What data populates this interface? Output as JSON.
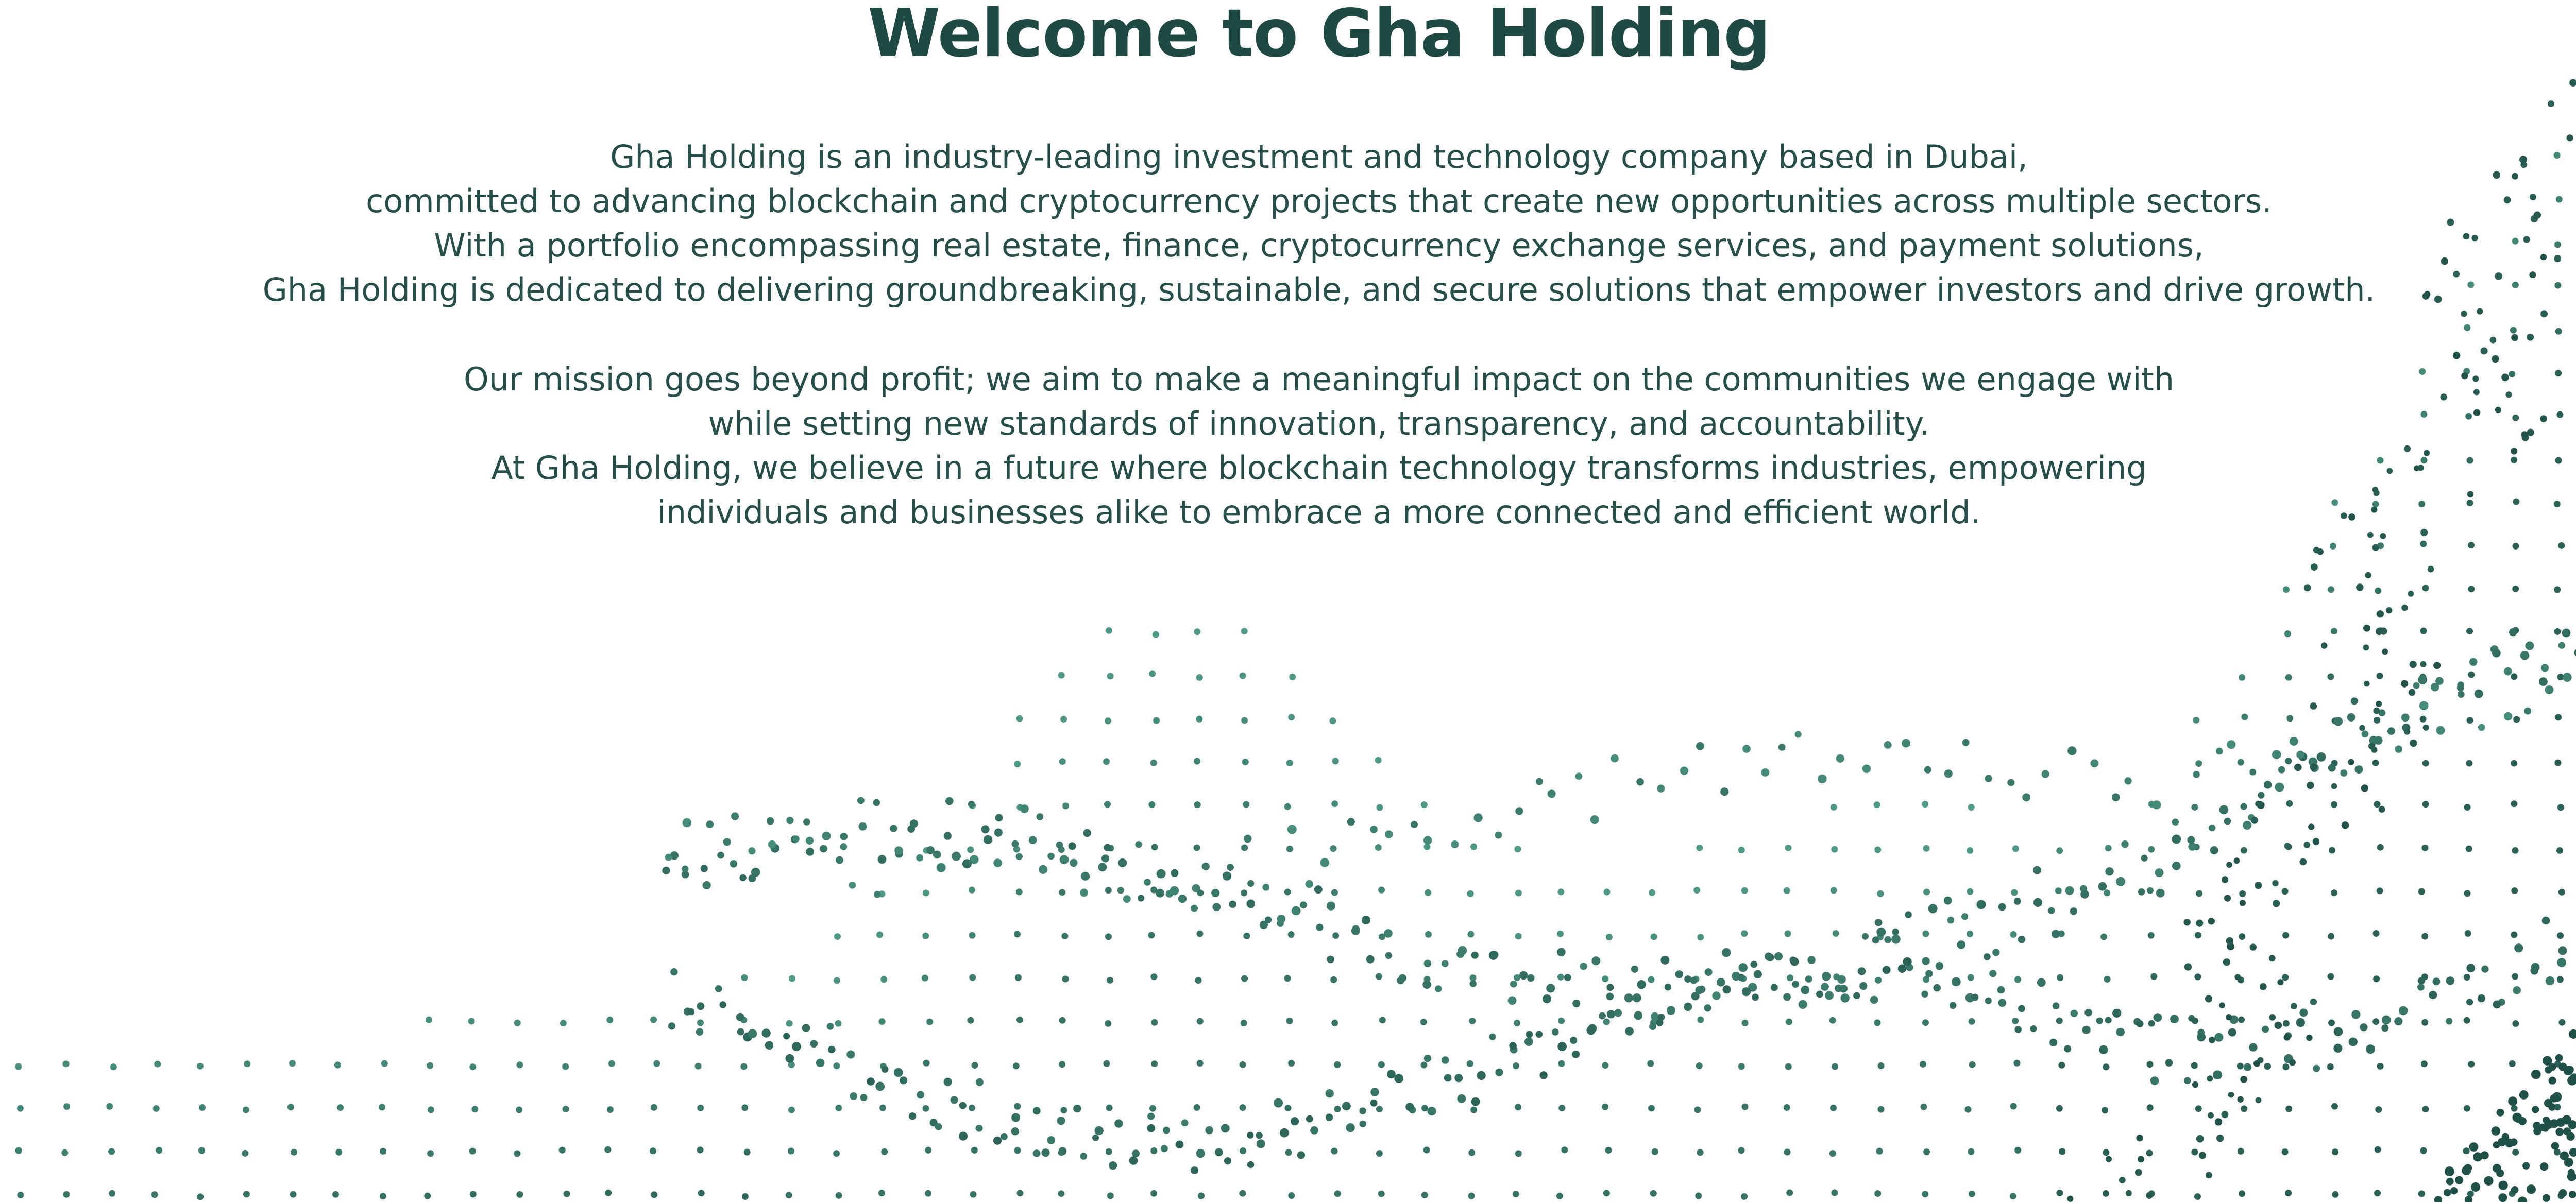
{
  "hero": {
    "title": "Welcome to Gha Holding",
    "paragraph_1": [
      "Gha Holding is an industry-leading investment and technology company based in Dubai,",
      "committed to advancing blockchain and cryptocurrency projects that create new opportunities across multiple sectors.",
      "With a portfolio encompassing real estate, finance, cryptocurrency exchange services, and payment solutions,",
      "Gha Holding is dedicated to delivering groundbreaking, sustainable, and secure solutions that empower investors and drive growth."
    ],
    "paragraph_2": [
      "Our mission goes beyond profit; we aim to make a meaningful impact on the communities we engage with",
      "while setting new standards of innovation, transparency, and accountability.",
      "At Gha Holding, we believe in a future where blockchain technology transforms industries, empowering",
      "individuals and businesses alike to embrace a more connected and efficient world."
    ]
  },
  "colors": {
    "text": "#1f4a43",
    "dot_dark": "#1e4d45",
    "dot_light": "#4f9a86",
    "background": "#ffffff"
  }
}
